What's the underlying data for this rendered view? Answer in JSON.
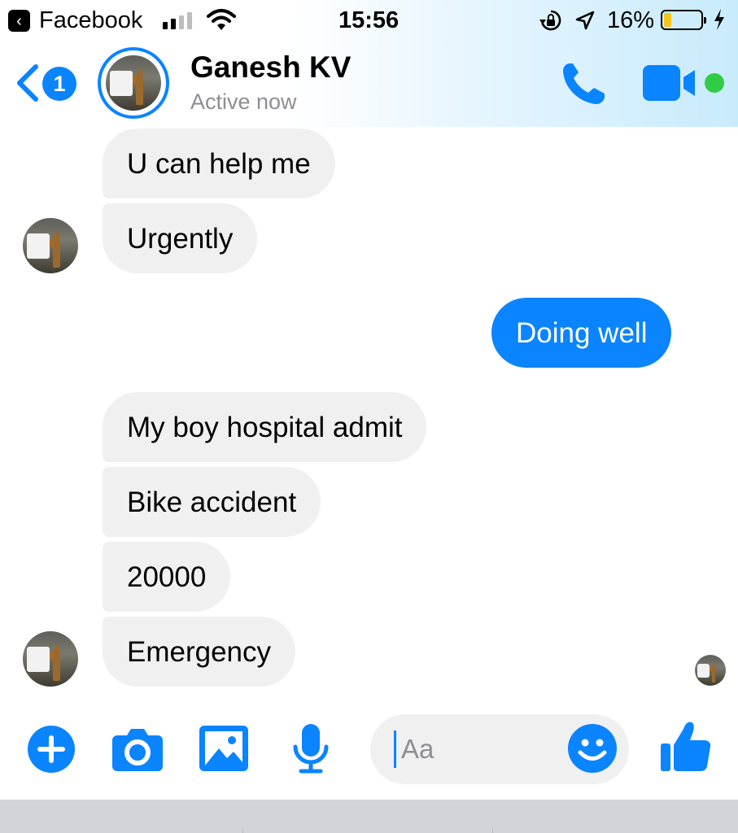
{
  "status_bar": {
    "back_app_label": "Facebook",
    "time": "15:56",
    "battery_percent": "16%",
    "battery_level": 0.16,
    "signal_bars_filled": 2,
    "signal_bars_total": 4
  },
  "header": {
    "back_badge_count": "1",
    "contact_name": "Ganesh KV",
    "contact_status": "Active now"
  },
  "messages": [
    {
      "direction": "incoming",
      "text": "U can help me"
    },
    {
      "direction": "incoming",
      "text": "Urgently"
    },
    {
      "direction": "outgoing",
      "text": "Doing well"
    },
    {
      "direction": "incoming",
      "text": "My boy hospital admit"
    },
    {
      "direction": "incoming",
      "text": "Bike accident"
    },
    {
      "direction": "incoming",
      "text": "20000"
    },
    {
      "direction": "incoming",
      "text": "Emergency"
    }
  ],
  "composer": {
    "placeholder": "Aa",
    "value": "",
    "icons": [
      "add-icon",
      "camera-icon",
      "image-icon",
      "microphone-icon",
      "emoji-icon",
      "like-icon"
    ]
  },
  "colors": {
    "accent": "#0a84ff",
    "incoming_bubble": "#f0f0f0",
    "outgoing_bubble": "#0a84ff",
    "online_dot": "#31cc46",
    "battery_fill": "#f5c518"
  }
}
